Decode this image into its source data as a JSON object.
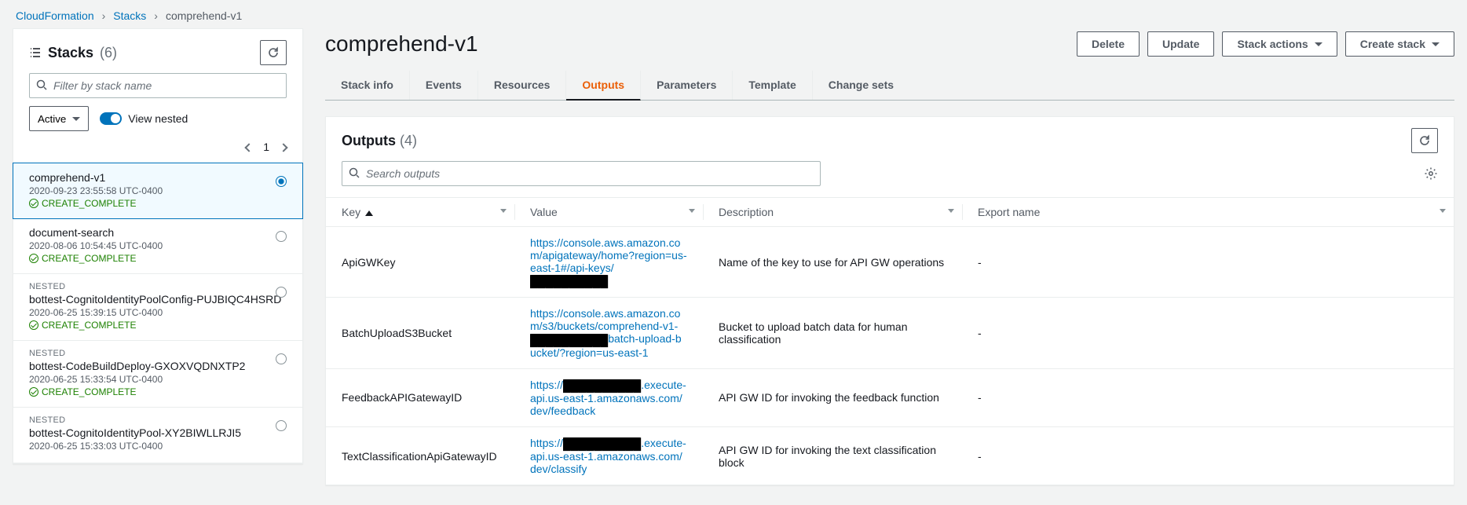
{
  "breadcrumb": {
    "root": "CloudFormation",
    "level2": "Stacks",
    "current": "comprehend-v1"
  },
  "sidebar": {
    "title": "Stacks",
    "count": "(6)",
    "filter_placeholder": "Filter by stack name",
    "status_filter": "Active",
    "view_nested": "View nested",
    "page_number": "1",
    "items": [
      {
        "nested": false,
        "name": "comprehend-v1",
        "date": "2020-09-23 23:55:58 UTC-0400",
        "status": "CREATE_COMPLETE",
        "selected": true
      },
      {
        "nested": false,
        "name": "document-search",
        "date": "2020-08-06 10:54:45 UTC-0400",
        "status": "CREATE_COMPLETE",
        "selected": false
      },
      {
        "nested": true,
        "nested_label": "NESTED",
        "name": "bottest-CognitoIdentityPoolConfig-PUJBIQC4HSRD",
        "date": "2020-06-25 15:39:15 UTC-0400",
        "status": "CREATE_COMPLETE",
        "selected": false
      },
      {
        "nested": true,
        "nested_label": "NESTED",
        "name": "bottest-CodeBuildDeploy-GXOXVQDNXTP2",
        "date": "2020-06-25 15:33:54 UTC-0400",
        "status": "CREATE_COMPLETE",
        "selected": false
      },
      {
        "nested": true,
        "nested_label": "NESTED",
        "name": "bottest-CognitoIdentityPool-XY2BIWLLRJI5",
        "date": "2020-06-25 15:33:03 UTC-0400",
        "status": "",
        "selected": false
      }
    ]
  },
  "main": {
    "title": "comprehend-v1",
    "actions": {
      "delete": "Delete",
      "update": "Update",
      "stack_actions": "Stack actions",
      "create_stack": "Create stack"
    },
    "tabs": [
      {
        "label": "Stack info",
        "active": false
      },
      {
        "label": "Events",
        "active": false
      },
      {
        "label": "Resources",
        "active": false
      },
      {
        "label": "Outputs",
        "active": true
      },
      {
        "label": "Parameters",
        "active": false
      },
      {
        "label": "Template",
        "active": false
      },
      {
        "label": "Change sets",
        "active": false
      }
    ],
    "outputs_panel": {
      "title": "Outputs",
      "count": "(4)",
      "search_placeholder": "Search outputs",
      "columns": {
        "key": "Key",
        "value": "Value",
        "description": "Description",
        "export": "Export name"
      },
      "rows": [
        {
          "key": "ApiGWKey",
          "value_parts": [
            "https://console.aws.amazon.com/apigateway/home?region=us-east-1#/api-keys/",
            "██████████"
          ],
          "desc": "Name of the key to use for API GW operations",
          "export": "-"
        },
        {
          "key": "BatchUploadS3Bucket",
          "value_parts": [
            "https://console.aws.amazon.com/s3/buckets/comprehend-v1-",
            "██████████",
            "batch-upload-bucket",
            "/?region=us-east-1"
          ],
          "desc": "Bucket to upload batch data for human classification",
          "export": "-"
        },
        {
          "key": "FeedbackAPIGatewayID",
          "value_parts": [
            "https://",
            "██████████",
            ".execute-api.us-east-1.amazonaws.com/dev/feedback"
          ],
          "desc": "API GW ID for invoking the feedback function",
          "export": "-"
        },
        {
          "key": "TextClassificationApiGatewayID",
          "value_parts": [
            "https://",
            "██████████",
            ".execute-api.us-east-1.amazonaws.com/dev/classify"
          ],
          "desc": "API GW ID for invoking the text classification block",
          "export": "-"
        }
      ]
    }
  }
}
